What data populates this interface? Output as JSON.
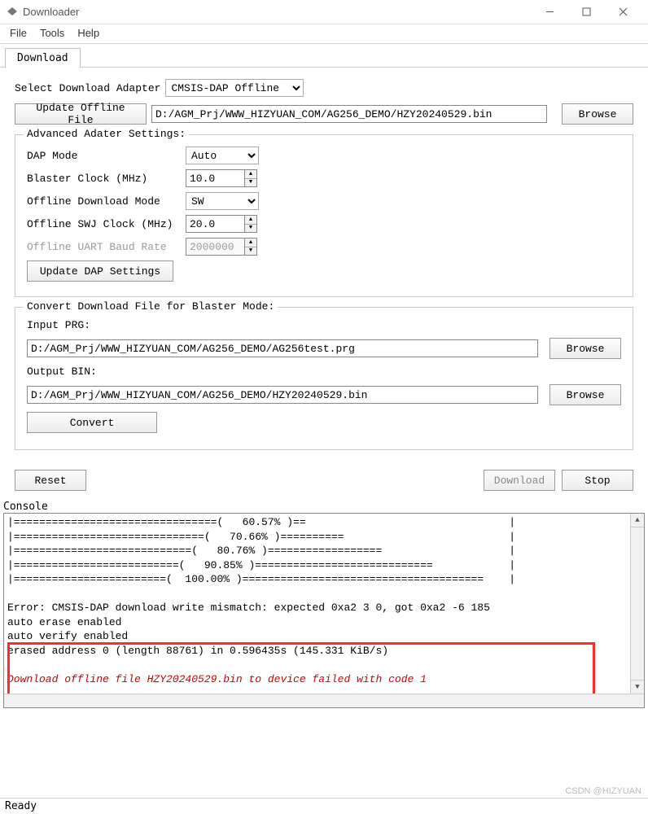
{
  "window": {
    "title": "Downloader"
  },
  "menus": {
    "file": "File",
    "tools": "Tools",
    "help": "Help"
  },
  "tab": {
    "download": "Download"
  },
  "adapter": {
    "label": "Select Download Adapter",
    "value": "CMSIS-DAP Offline"
  },
  "updateFile": {
    "button": "Update Offline File",
    "path": "D:/AGM_Prj/WWW_HIZYUAN_COM/AG256_DEMO/HZY20240529.bin",
    "browse": "Browse"
  },
  "advanced": {
    "legend": "Advanced Adater Settings:",
    "dapMode": {
      "label": "DAP Mode",
      "value": "Auto"
    },
    "blasterClock": {
      "label": "Blaster Clock (MHz)",
      "value": "10.0"
    },
    "offlineMode": {
      "label": "Offline Download Mode",
      "value": "SW"
    },
    "swjClock": {
      "label": "Offline SWJ Clock (MHz)",
      "value": "20.0"
    },
    "uartBaud": {
      "label": "Offline UART Baud Rate",
      "value": "2000000"
    },
    "updateBtn": "Update DAP Settings"
  },
  "convert": {
    "legend": "Convert Download File for Blaster Mode:",
    "inputLabel": "Input PRG:",
    "inputPath": "D:/AGM_Prj/WWW_HIZYUAN_COM/AG256_DEMO/AG256test.prg",
    "outputLabel": "Output BIN:",
    "outputPath": "D:/AGM_Prj/WWW_HIZYUAN_COM/AG256_DEMO/HZY20240529.bin",
    "browse": "Browse",
    "convertBtn": "Convert"
  },
  "actions": {
    "reset": "Reset",
    "download": "Download",
    "stop": "Stop"
  },
  "console": {
    "label": "Console",
    "line1": "|================================(   60.57% )==                                |",
    "line2": "|==============================(   70.66% )==========                          |",
    "line3": "|============================(   80.76% )==================                    |",
    "line4": "|==========================(   90.85% )============================            |",
    "line5": "|========================(  100.00% )======================================    |",
    "blank": "",
    "err1": "Error: CMSIS-DAP download write mismatch: expected 0xa2 3 0, got 0xa2 -6 185",
    "err2": "auto erase enabled",
    "err3": "auto verify enabled",
    "err4": "erased address 0 (length 88761) in 0.596435s (145.331 KiB/s)",
    "failPrefix": "Download offline file HZY20240529.bin to device ",
    "failWord": "failed",
    "failMid": " with code ",
    "failCode": "1"
  },
  "status": "Ready",
  "watermark": "CSDN @HIZYUAN"
}
